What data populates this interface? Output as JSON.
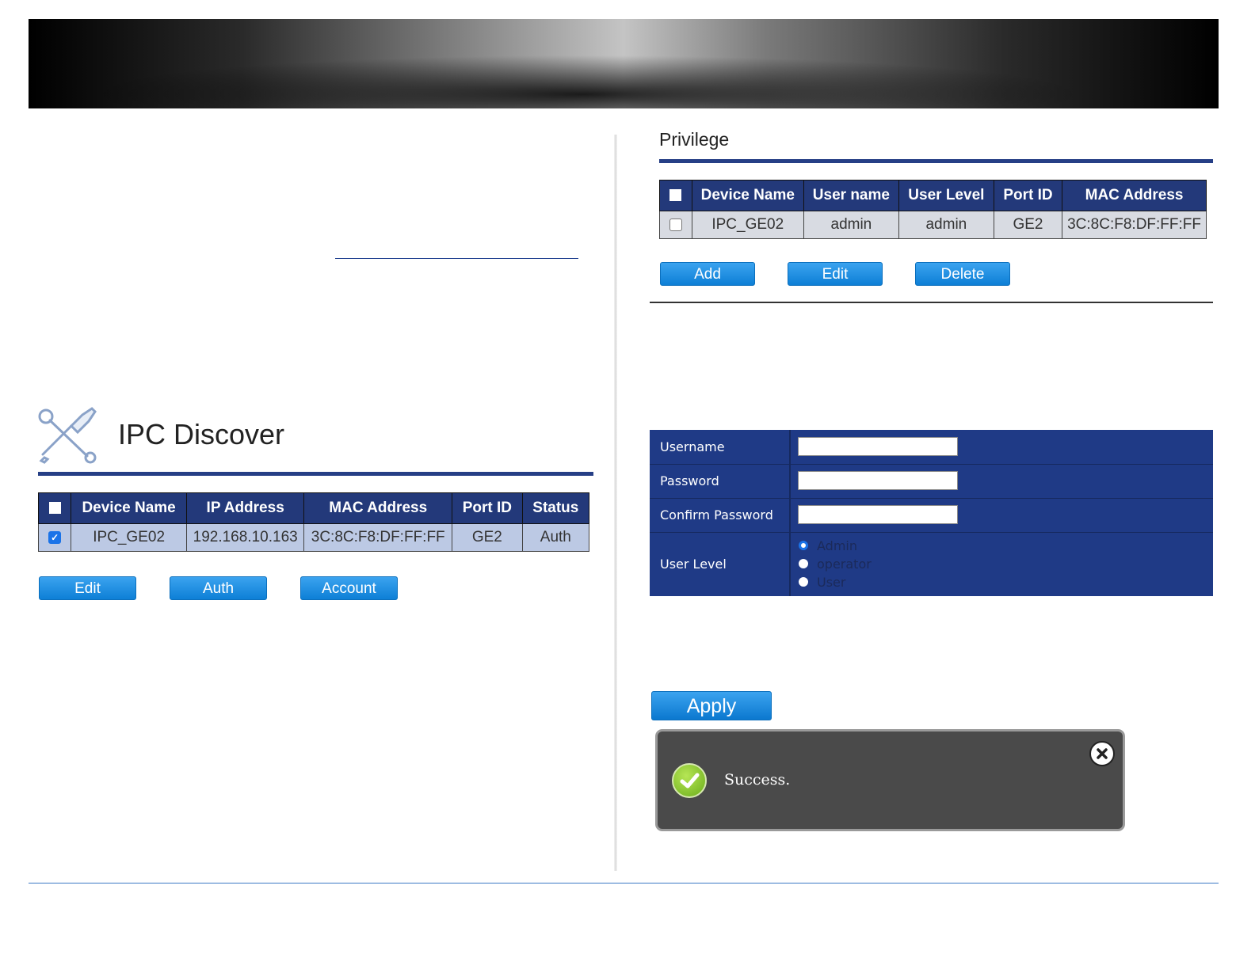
{
  "left": {
    "title": "IPC Discover",
    "table": {
      "headers": [
        "Device Name",
        "IP Address",
        "MAC Address",
        "Port ID",
        "Status"
      ],
      "rows": [
        {
          "checked": true,
          "cells": [
            "IPC_GE02",
            "192.168.10.163",
            "3C:8C:F8:DF:FF:FF",
            "GE2",
            "Auth"
          ]
        }
      ]
    },
    "buttons": {
      "edit": "Edit",
      "auth": "Auth",
      "account": "Account"
    }
  },
  "right": {
    "title": "Privilege",
    "table": {
      "headers": [
        "Device Name",
        "User name",
        "User Level",
        "Port ID",
        "MAC Address"
      ],
      "rows": [
        {
          "checked": false,
          "cells": [
            "IPC_GE02",
            "admin",
            "admin",
            "GE2",
            "3C:8C:F8:DF:FF:FF"
          ]
        }
      ]
    },
    "buttons": {
      "add": "Add",
      "edit": "Edit",
      "delete": "Delete"
    },
    "form": {
      "username_label": "Username",
      "username_value": "",
      "password_label": "Password",
      "password_value": "",
      "confirm_label": "Confirm Password",
      "confirm_value": "",
      "level_label": "User Level",
      "levels": [
        {
          "label": "Admin",
          "selected": true
        },
        {
          "label": "operator",
          "selected": false
        },
        {
          "label": "User",
          "selected": false
        }
      ]
    },
    "apply_label": "Apply",
    "toast": {
      "message": "Success."
    }
  },
  "colors": {
    "header_blue": "#23397a",
    "form_blue": "#1f3a86",
    "button_blue": "#1c8be3",
    "success_green": "#7cbf25"
  }
}
